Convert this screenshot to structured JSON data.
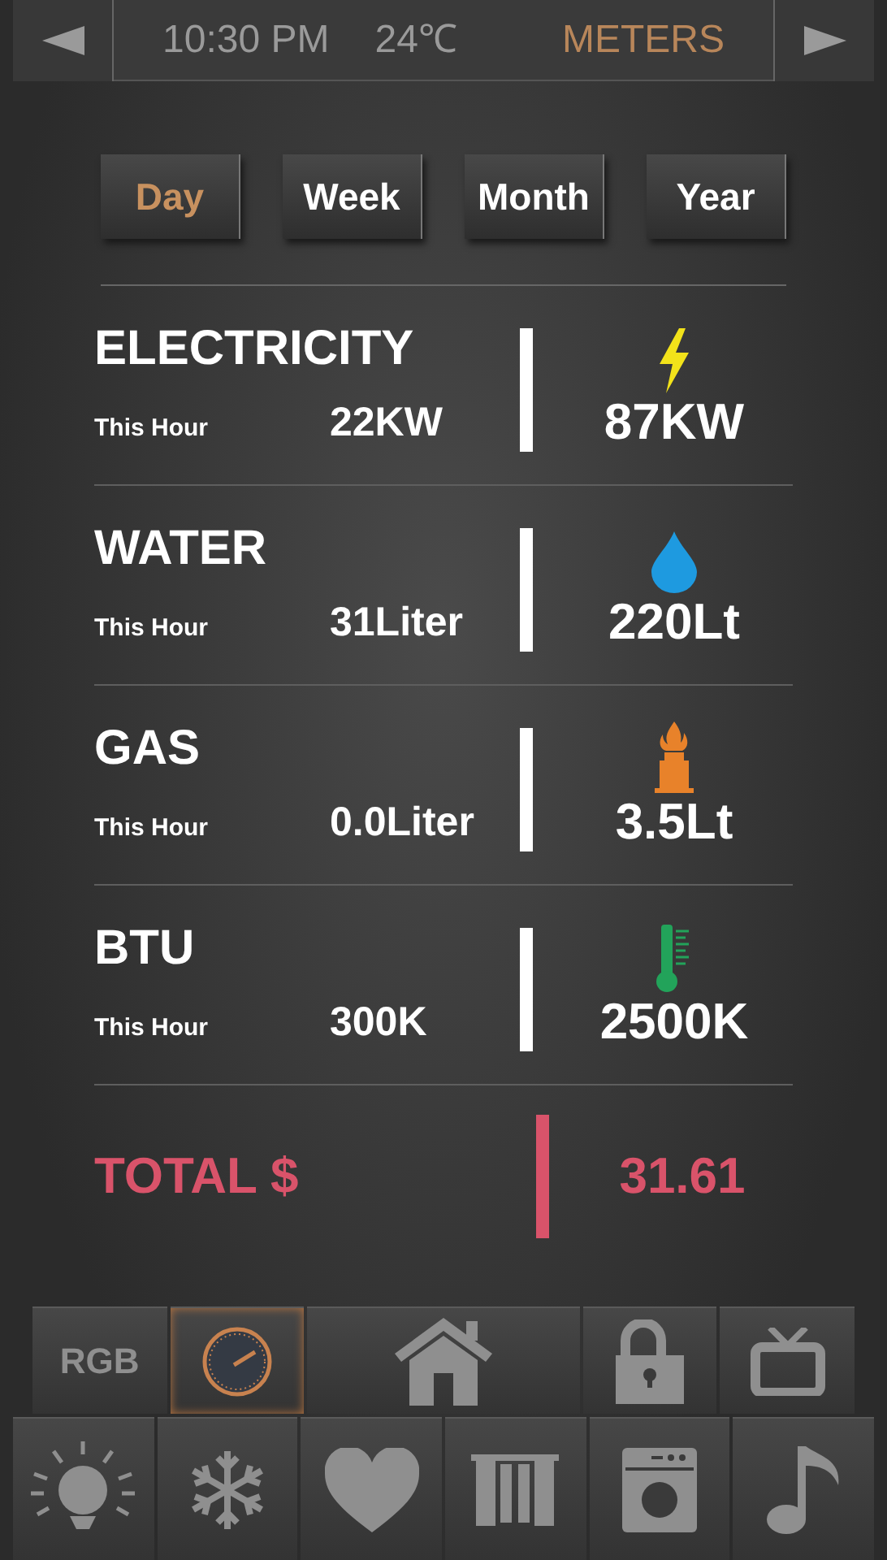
{
  "top_bar": {
    "time": "10:30 PM",
    "temperature": "24℃",
    "title": "METERS"
  },
  "periods": [
    {
      "label": "Day",
      "selected": true
    },
    {
      "label": "Week",
      "selected": false
    },
    {
      "label": "Month",
      "selected": false
    },
    {
      "label": "Year",
      "selected": false
    }
  ],
  "meters": [
    {
      "kind": "electricity",
      "name": "ELECTRICITY",
      "caption": "This Hour",
      "hour_value": "22KW",
      "total": "87KW"
    },
    {
      "kind": "water",
      "name": "WATER",
      "caption": "This Hour",
      "hour_value": "31Liter",
      "total": "220Lt"
    },
    {
      "kind": "gas",
      "name": "GAS",
      "caption": "This Hour",
      "hour_value": "0.0Liter",
      "total": "3.5Lt"
    },
    {
      "kind": "btu",
      "name": "BTU",
      "caption": "This Hour",
      "hour_value": "300K",
      "total": "2500K"
    }
  ],
  "total": {
    "label": "TOTAL $",
    "value": "31.61"
  },
  "tiles": [
    [
      {
        "kind": "rgb",
        "label": "RGB",
        "selected": false
      },
      {
        "kind": "gauge",
        "selected": true
      },
      {
        "kind": "home",
        "selected": false,
        "wide": true
      },
      {
        "kind": "lock",
        "selected": false
      },
      {
        "kind": "tv",
        "selected": false
      }
    ],
    [
      {
        "kind": "light",
        "selected": false
      },
      {
        "kind": "snowflake",
        "selected": false
      },
      {
        "kind": "heart",
        "selected": false
      },
      {
        "kind": "curtain",
        "selected": false
      },
      {
        "kind": "washer",
        "selected": false
      },
      {
        "kind": "music",
        "selected": false
      }
    ]
  ]
}
